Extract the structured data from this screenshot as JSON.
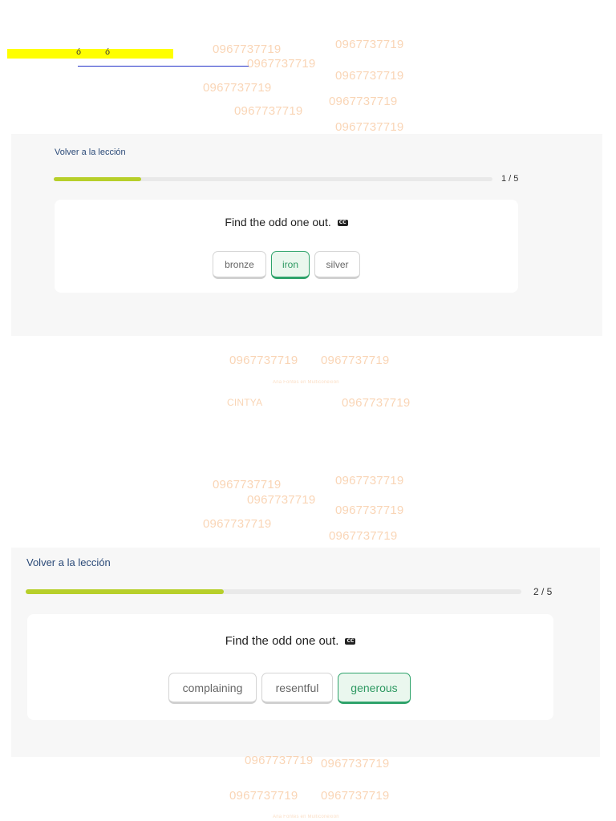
{
  "watermark": {
    "phone": "0967737719",
    "name": "CINTYA",
    "tiny": "Ana Fontes en Multiconexión"
  },
  "highlight": {
    "glyph_a": "ó",
    "glyph_b": "ó"
  },
  "exercise1": {
    "back_label": "Volver a la lección",
    "progress": 0.2,
    "counter": "1 / 5",
    "prompt": "Find the odd one out.",
    "cc_icon": "caption-icon",
    "options": [
      {
        "label": "bronze",
        "selected": false
      },
      {
        "label": "iron",
        "selected": true
      },
      {
        "label": "silver",
        "selected": false
      }
    ]
  },
  "exercise2": {
    "back_label": "Volver a la lección",
    "progress": 0.4,
    "counter": "2 / 5",
    "prompt": "Find the odd one out.",
    "cc_icon": "caption-icon",
    "options": [
      {
        "label": "complaining",
        "selected": false
      },
      {
        "label": "resentful",
        "selected": false
      },
      {
        "label": "generous",
        "selected": true
      }
    ]
  },
  "colors": {
    "progress_fill": "#b7cf2a",
    "selected_green": "#2fa36b",
    "panel_bg": "#f7f7f7",
    "watermark": "#f8c89e"
  }
}
